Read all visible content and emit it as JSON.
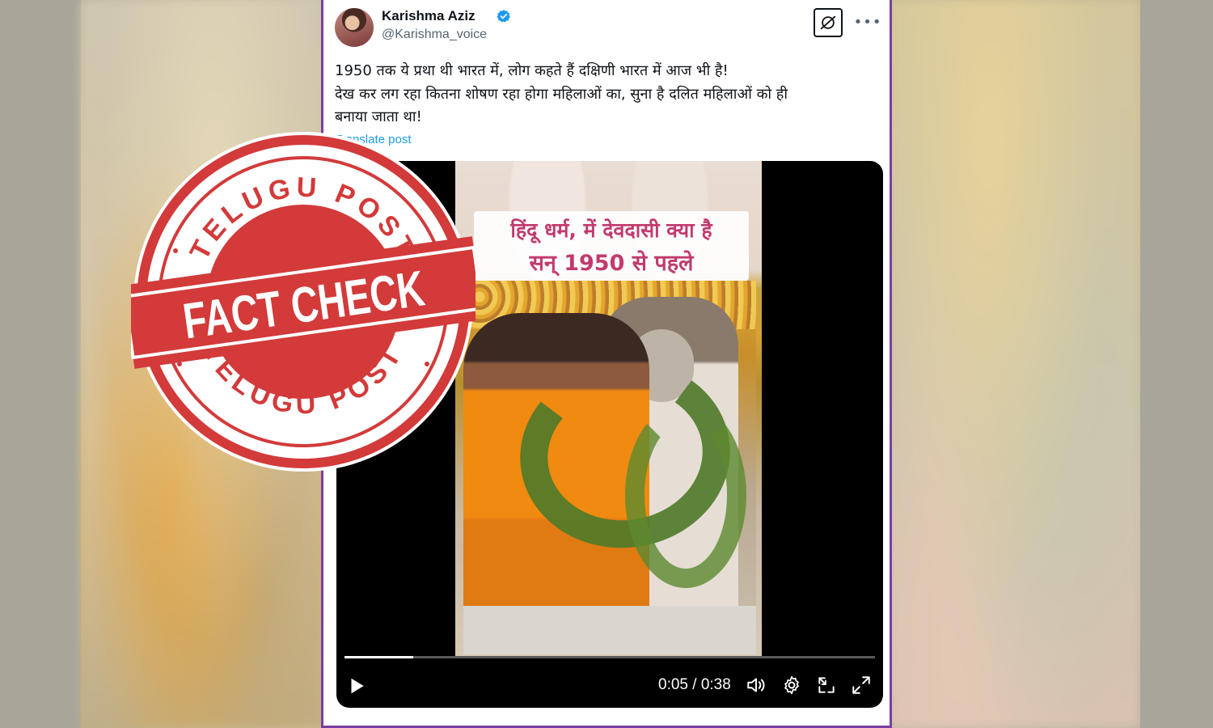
{
  "tweet": {
    "author_name": "Karishma Aziz",
    "author_handle": "@Karishma_voice",
    "text_lines": [
      "1950 तक ये प्रथा थी भारत में, लोग कहते हैं दक्षिणी भारत में आज भी है!",
      "देख कर लग रहा कितना शोषण रहा होगा महिलाओं का, सुना है दलित महिलाओं को ही",
      "बनाया जाता था!"
    ],
    "translate_label": "Translate post",
    "more_icon": "more-icon",
    "grok_icon": "grok-icon"
  },
  "video": {
    "caption_line1": "हिंदू धर्म, में देवदासी क्या है",
    "caption_line2": "सन् 1950 से पहले",
    "time": "0:05 / 0:38",
    "progress": 0.13,
    "icons": [
      "play-icon",
      "volume-icon",
      "settings-icon",
      "minimize-icon",
      "fullscreen-icon"
    ]
  },
  "stamp": {
    "top_text": "TELUGU POST",
    "center_text": "FACT CHECK",
    "bottom_text": "TELUGU POST",
    "color": "#d33a3a"
  },
  "colors": {
    "frame_border": "#7a3fa0",
    "link": "#1d9bf0",
    "verified": "#1d9bf0",
    "caption": "#c23a6e"
  }
}
